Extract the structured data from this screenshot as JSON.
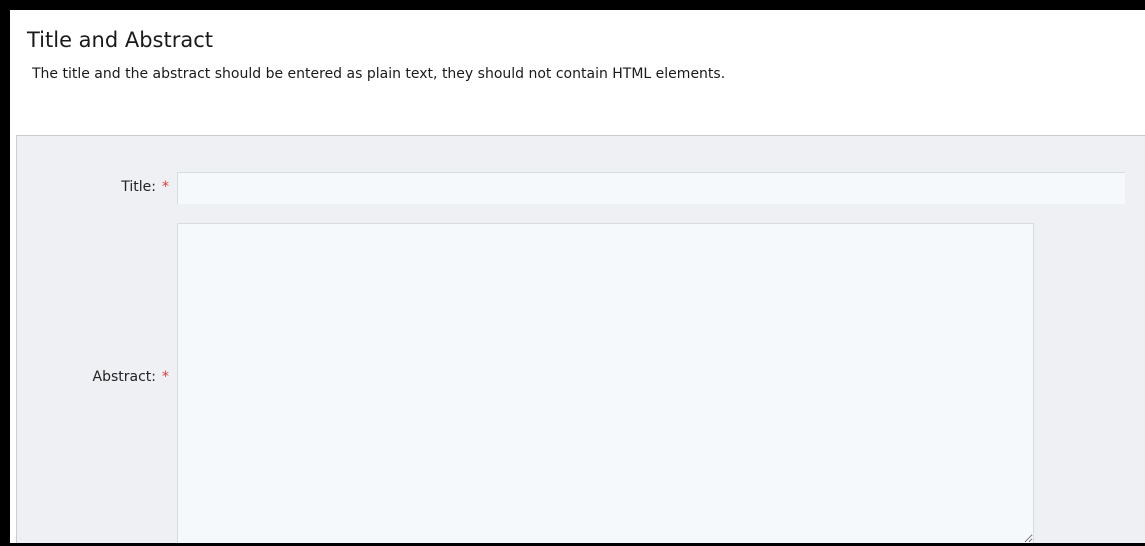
{
  "section": {
    "title": "Title and Abstract",
    "description": "The title and the abstract should be entered as plain text, they should not contain HTML elements."
  },
  "form": {
    "title_field": {
      "label": "Title:",
      "required_marker": "*",
      "value": ""
    },
    "abstract_field": {
      "label": "Abstract:",
      "required_marker": "*",
      "value": ""
    }
  },
  "colors": {
    "frame": "#000000",
    "panel_background": "#eef0f3",
    "input_background": "#f6f9fc",
    "required_marker": "#e03a3a"
  },
  "icons": {
    "textarea_resize": "resize-grip-icon"
  }
}
